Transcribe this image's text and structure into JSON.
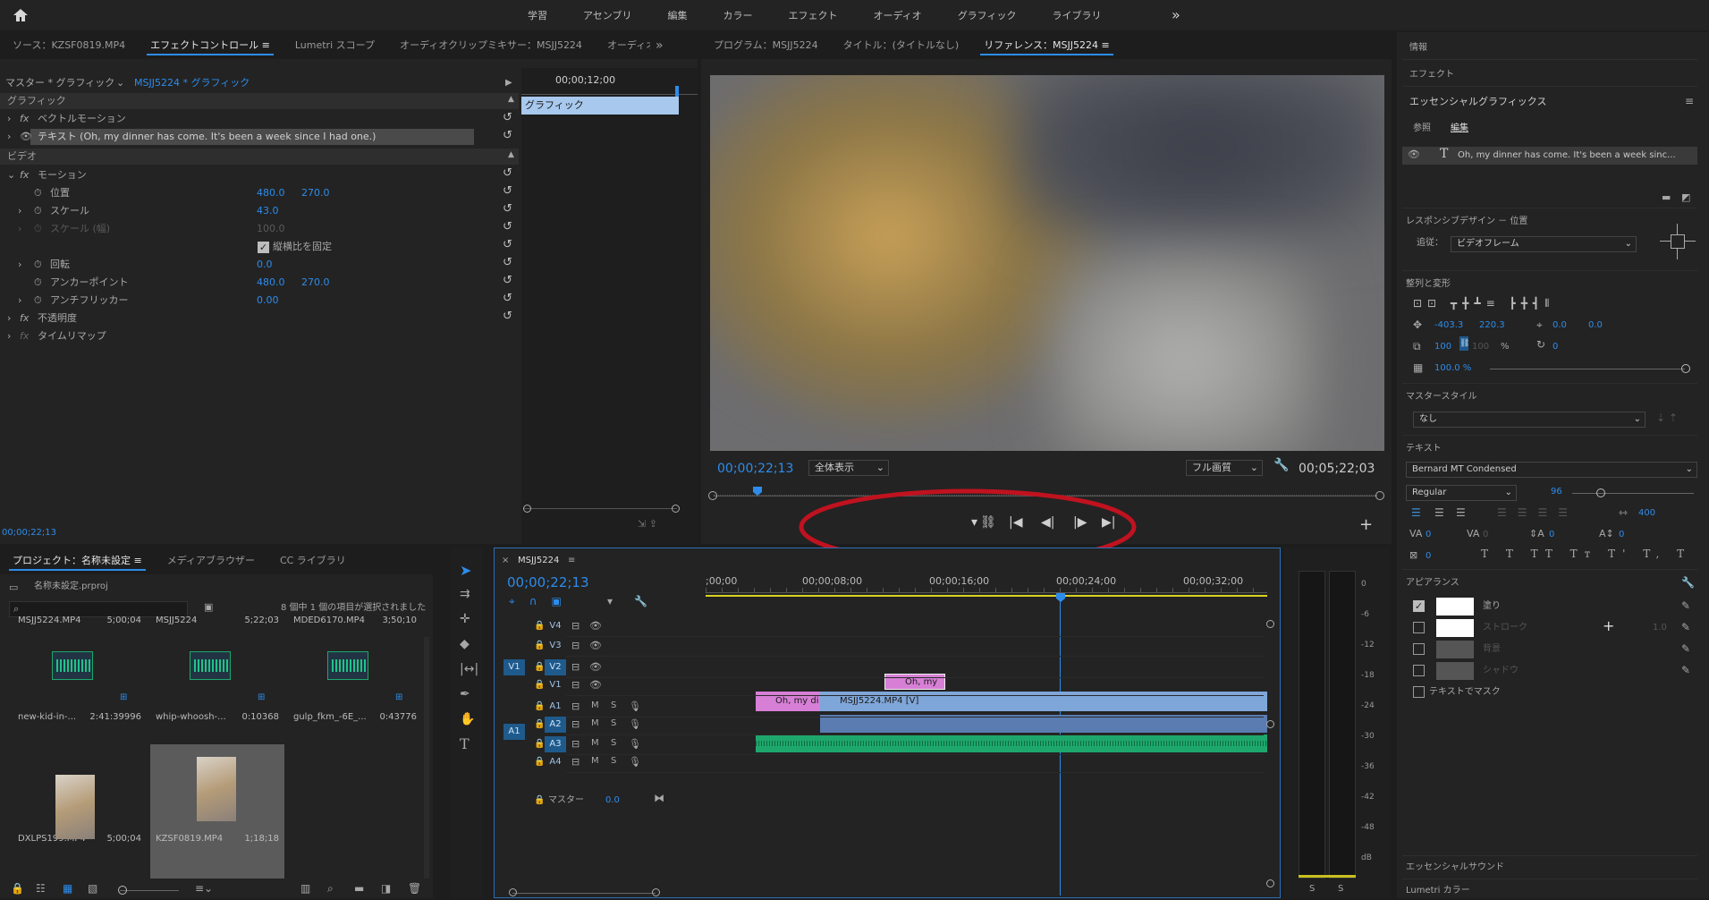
{
  "workspaces": {
    "items": [
      "学習",
      "アセンブリ",
      "編集",
      "カラー",
      "エフェクト",
      "オーディオ",
      "グラフィック",
      "ライブラリ"
    ],
    "more": "»"
  },
  "source_tabs": {
    "source": "ソース：KZSF0819.MP4",
    "effect_controls": "エフェクトコントロール",
    "lumetri": "Lumetri スコープ",
    "audio_mixer": "オーディオクリップミキサー：MSJJ5224",
    "audio_cut": "オーディオ",
    "more": "»"
  },
  "effect_controls": {
    "breadcrumb_master": "マスター * グラフィック",
    "breadcrumb_clip": "MSJJ5224 * グラフィック",
    "timecode": "00;00;12;00",
    "clip_bar": "グラフィック",
    "section_graphic": "グラフィック",
    "vector_motion": "ベクトルモーション",
    "text_layer": "テキスト (Oh, my dinner has come. It's been a week since I had one.)",
    "section_video": "ビデオ",
    "motion": "モーション",
    "position": "位置",
    "position_x": "480.0",
    "position_y": "270.0",
    "scale": "スケール",
    "scale_val": "43.0",
    "scale_w": "スケール (幅)",
    "scale_w_val": "100.0",
    "uniform": "縦横比を固定",
    "rotation": "回転",
    "rotation_val": "0.0",
    "anchor": "アンカーポイント",
    "anchor_x": "480.0",
    "anchor_y": "270.0",
    "antiflicker": "アンチフリッカー",
    "antiflicker_val": "0.00",
    "opacity": "不透明度",
    "timeremap": "タイムリマップ",
    "footer_tc": "00;00;22;13"
  },
  "program": {
    "tabs": {
      "program": "プログラム：MSJJ5224",
      "title": "タイトル：(タイトルなし)",
      "reference": "リファレンス：MSJJ5224"
    },
    "timecode": "00;00;22;13",
    "zoom": "全体表示",
    "quality": "フル画質",
    "duration": "00;05;22;03"
  },
  "project": {
    "tabs": {
      "project": "プロジェクト：名称未設定",
      "media": "メディアブラウザー",
      "cc": "CC ライブラリ"
    },
    "file": "名称未設定.prproj",
    "selection": "8 個中 1 個の項目が選択されました",
    "items": [
      {
        "name": "MSJJ5224.MP4",
        "dur": "5;00;04",
        "label": "new-kid-in-...",
        "sub": "2:41:39996"
      },
      {
        "name": "MSJJ5224",
        "dur": "5;22;03",
        "label": "whip-whoosh-...",
        "sub": "0:10368"
      },
      {
        "name": "MDED6170.MP4",
        "dur": "3;50;10",
        "label": "gulp_fkm_-6E_...",
        "sub": "0:43776"
      },
      {
        "name": "DXLPS199.MP4",
        "dur": "5;00;04"
      },
      {
        "name": "KZSF0819.MP4",
        "dur": "1;18;18"
      }
    ]
  },
  "timeline": {
    "tab": "MSJJ5224",
    "timecode": "00;00;22;13",
    "ruler": [
      ";00;00",
      "00;00;08;00",
      "00;00;16;00",
      "00;00;24;00",
      "00;00;32;00"
    ],
    "tracks_v": [
      "V4",
      "V3",
      "V2",
      "V1"
    ],
    "tracks_a": [
      "A1",
      "A2",
      "A3",
      "A4"
    ],
    "src_v": "V1",
    "src_a": "A1",
    "mute": "M",
    "solo": "S",
    "master": "マスター",
    "master_val": "0.0",
    "clip_graphic_v2": "Oh, my di",
    "clip_graphic_v1": "Oh, my di",
    "clip_video": "MSJJ5224.MP4 [V]"
  },
  "meter": {
    "scale": [
      "0",
      "-6",
      "-12",
      "-18",
      "-24",
      "-30",
      "-36",
      "-42",
      "-48",
      "dB"
    ],
    "s1": "S",
    "s2": "S"
  },
  "essential": {
    "info": "情報",
    "effects": "エフェクト",
    "title": "エッセンシャルグラフィックス",
    "tab_browse": "参照",
    "tab_edit": "編集",
    "layer_text": "Oh, my dinner has come. It's been a week sinc...",
    "responsive": "レスポンシブデザイン － 位置",
    "follow": "追従：",
    "follow_val": "ビデオフレーム",
    "align": "整列と変形",
    "pos_x": "-403.3",
    "pos_y": "220.3",
    "anchor_x": "0.0",
    "anchor_y": "0.0",
    "scale": "100",
    "scale2": "100",
    "percent": "%",
    "rotation": "0",
    "opacity": "100.0 %",
    "master_style": "マスタースタイル",
    "style_val": "なし",
    "text": "テキスト",
    "font": "Bernard MT Condensed",
    "font_style": "Regular",
    "font_size": "96",
    "tracking": "400",
    "kern": "0",
    "leading": "0",
    "baseline": "0",
    "tsume": "0",
    "rot": "0",
    "appearance": "アピアランス",
    "fill": "塗り",
    "stroke": "ストローク",
    "stroke_w": "1.0",
    "bg": "背景",
    "shadow": "シャドウ",
    "mask": "テキストでマスク",
    "sound": "エッセンシャルサウンド",
    "lumetri": "Lumetri カラー"
  },
  "colors": {
    "accent": "#2d8ceb",
    "annotation": "#c0121f",
    "graphic_clip": "#d77fd6",
    "video_clip": "#7fa6d9",
    "audio_clip": "#1ea76c"
  }
}
